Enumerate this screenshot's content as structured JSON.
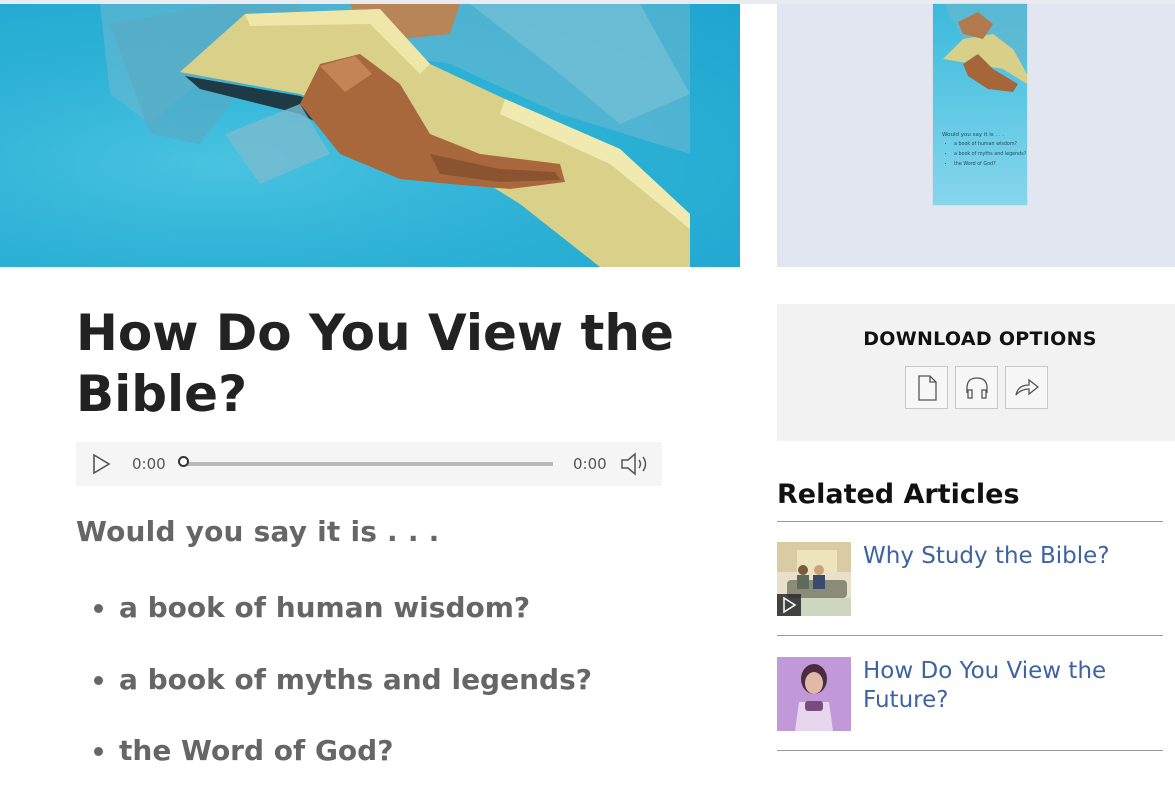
{
  "article": {
    "title": "How Do You View the Bible?",
    "lead": "Would you say it is . . .",
    "questions": [
      "a book of human wisdom?",
      "a book of myths and legends?",
      "the Word of God?"
    ]
  },
  "audio_player": {
    "current_time": "0:00",
    "duration": "0:00",
    "progress": 0,
    "icons": {
      "play": "play-icon",
      "volume": "volume-icon"
    }
  },
  "brochure_thumbnail": {
    "lead": "Would you say it is . . .",
    "items": [
      "a book of human wisdom?",
      "a book of myths and legends?",
      "the Word of God?"
    ]
  },
  "download": {
    "title": "DOWNLOAD OPTIONS",
    "icons": [
      "document-icon",
      "headphones-icon",
      "share-icon"
    ]
  },
  "related": {
    "heading": "Related Articles",
    "items": [
      {
        "title": "Why Study the Bible?",
        "has_video": true
      },
      {
        "title": "How Do You View the Future?",
        "has_video": false
      }
    ]
  },
  "colors": {
    "link": "#3f63a0",
    "hero_background": "#2eb2d6",
    "panel_background": "#e2e6f1"
  }
}
